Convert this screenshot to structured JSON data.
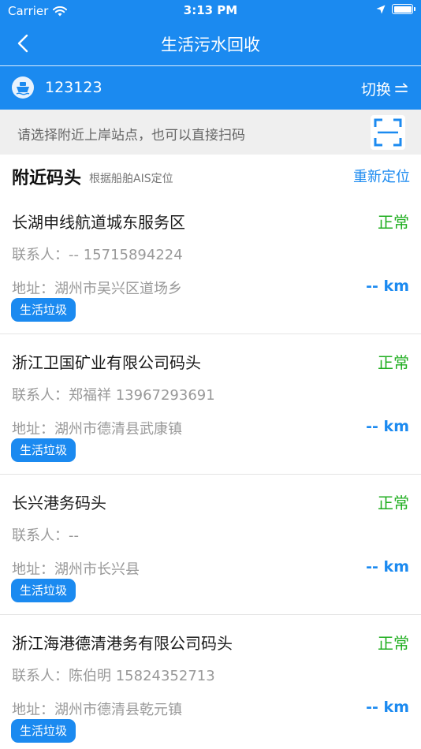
{
  "status_bar": {
    "carrier": "Carrier",
    "time": "3:13 PM"
  },
  "nav": {
    "title": "生活污水回收",
    "back_icon": "chevron-left-icon"
  },
  "ship": {
    "id": "123123",
    "switch_label": "切换"
  },
  "hint": {
    "text": "请选择附近上岸站点，也可以直接扫码"
  },
  "section": {
    "title": "附近码头",
    "subtitle": "根据船舶AIS定位",
    "relocate_label": "重新定位"
  },
  "colors": {
    "primary": "#1b8af0",
    "status_ok": "#1fae1f",
    "hint_bg": "#efefef"
  },
  "docks": [
    {
      "name": "长湖申线航道城东服务区",
      "status": "正常",
      "contact": "联系人：-- 15715894224",
      "address": "地址：湖州市吴兴区道场乡",
      "distance": "-- km",
      "tag": "生活垃圾"
    },
    {
      "name": "浙江卫国矿业有限公司码头",
      "status": "正常",
      "contact": "联系人：郑福祥 13967293691",
      "address": "地址：湖州市德清县武康镇",
      "distance": "-- km",
      "tag": "生活垃圾"
    },
    {
      "name": "长兴港务码头",
      "status": "正常",
      "contact": "联系人：--",
      "address": "地址：湖州市长兴县",
      "distance": "-- km",
      "tag": "生活垃圾"
    },
    {
      "name": "浙江海港德清港务有限公司码头",
      "status": "正常",
      "contact": "联系人：陈伯明 15824352713",
      "address": "地址：湖州市德清县乾元镇",
      "distance": "-- km",
      "tag": "生活垃圾"
    }
  ]
}
